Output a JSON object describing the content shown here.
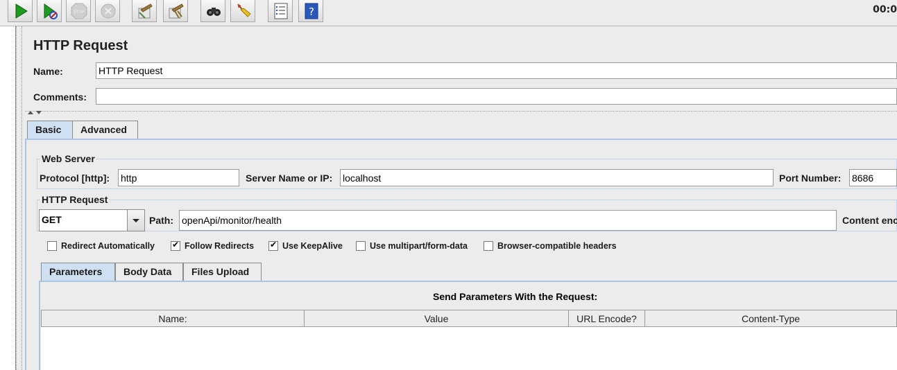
{
  "toolbar": {
    "timer": "00:0",
    "buttons": [
      {
        "name": "start-icon"
      },
      {
        "name": "start-no-pauses-icon"
      },
      {
        "name": "stop-icon"
      },
      {
        "name": "shutdown-icon"
      },
      {
        "name": "clear-icon"
      },
      {
        "name": "clear-all-icon"
      },
      {
        "name": "search-binoculars-icon"
      },
      {
        "name": "reset-search-broom-icon"
      },
      {
        "name": "function-helper-list-icon"
      },
      {
        "name": "help-icon"
      }
    ]
  },
  "header": {
    "title": "HTTP Request",
    "name_label": "Name:",
    "name_value": "HTTP Request",
    "comments_label": "Comments:",
    "comments_value": ""
  },
  "tabs": [
    {
      "label": "Basic",
      "active": true
    },
    {
      "label": "Advanced",
      "active": false
    }
  ],
  "web_server": {
    "title": "Web Server",
    "protocol_label": "Protocol [http]:",
    "protocol_value": "http",
    "server_label": "Server Name or IP:",
    "server_value": "localhost",
    "port_label": "Port Number:",
    "port_value": "8686"
  },
  "http_request": {
    "title": "HTTP Request",
    "method": "GET",
    "path_label": "Path:",
    "path_value": "openApi/monitor/health",
    "content_encoding_label": "Content enc"
  },
  "options": [
    {
      "label": "Redirect Automatically",
      "checked": false
    },
    {
      "label": "Follow Redirects",
      "checked": true
    },
    {
      "label": "Use KeepAlive",
      "checked": true
    },
    {
      "label": "Use multipart/form-data",
      "checked": false
    },
    {
      "label": "Browser-compatible headers",
      "checked": false
    }
  ],
  "param_tabs": [
    {
      "label": "Parameters",
      "active": true
    },
    {
      "label": "Body Data",
      "active": false
    },
    {
      "label": "Files Upload",
      "active": false
    }
  ],
  "params_table": {
    "title": "Send Parameters With the Request:",
    "columns": [
      "Name:",
      "Value",
      "URL Encode?",
      "Content-Type"
    ]
  },
  "colors": {
    "accent_tab": "#cfe0f2",
    "tab_line": "#a9c3e2",
    "start_green": "#1e9a1e"
  }
}
